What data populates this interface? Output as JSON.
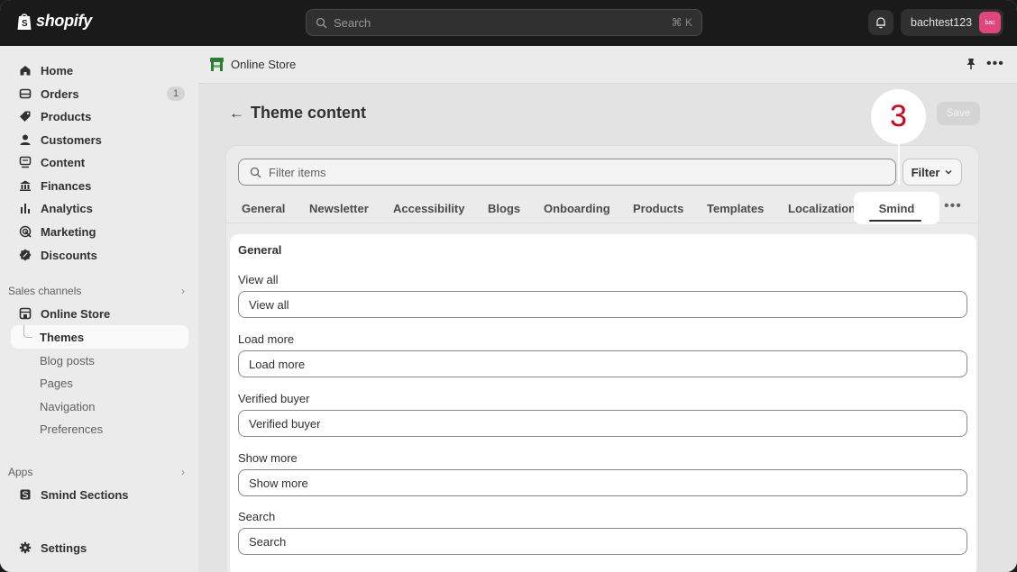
{
  "topbar": {
    "logo_text": "shopify",
    "search_placeholder": "Search",
    "search_shortcut": "⌘ K",
    "account_name": "bachtest123",
    "avatar_initials": "bac"
  },
  "sidebar": {
    "items": [
      {
        "label": "Home",
        "icon": "home-icon"
      },
      {
        "label": "Orders",
        "icon": "orders-icon",
        "badge": "1"
      },
      {
        "label": "Products",
        "icon": "tag-icon"
      },
      {
        "label": "Customers",
        "icon": "person-icon"
      },
      {
        "label": "Content",
        "icon": "content-icon"
      },
      {
        "label": "Finances",
        "icon": "bank-icon"
      },
      {
        "label": "Analytics",
        "icon": "bar-chart-icon"
      },
      {
        "label": "Marketing",
        "icon": "target-icon"
      },
      {
        "label": "Discounts",
        "icon": "discount-icon"
      }
    ],
    "sales_channels_label": "Sales channels",
    "online_store_label": "Online Store",
    "online_store_sub": [
      "Themes",
      "Blog posts",
      "Pages",
      "Navigation",
      "Preferences"
    ],
    "apps_label": "Apps",
    "app_item_label": "Smind Sections",
    "settings_label": "Settings"
  },
  "header": {
    "store_title": "Online Store"
  },
  "page": {
    "title": "Theme content",
    "save_label": "Save",
    "filter_placeholder": "Filter items",
    "filter_button": "Filter",
    "tabs": [
      "General",
      "Newsletter",
      "Accessibility",
      "Blogs",
      "Onboarding",
      "Products",
      "Templates",
      "Localization",
      "Smind"
    ],
    "active_tab": "Smind",
    "section_title": "General",
    "fields": [
      {
        "label": "View all",
        "value": "View all"
      },
      {
        "label": "Load more",
        "value": "Load more"
      },
      {
        "label": "Verified buyer",
        "value": "Verified buyer"
      },
      {
        "label": "Show more",
        "value": "Show more"
      },
      {
        "label": "Search",
        "value": "Search"
      }
    ]
  },
  "callout": {
    "step_number": "3",
    "color": "#d0021b"
  },
  "colors": {
    "topbar": "#1a1a1a",
    "sidebar": "#ebebeb",
    "avatar": "#e0457b"
  }
}
